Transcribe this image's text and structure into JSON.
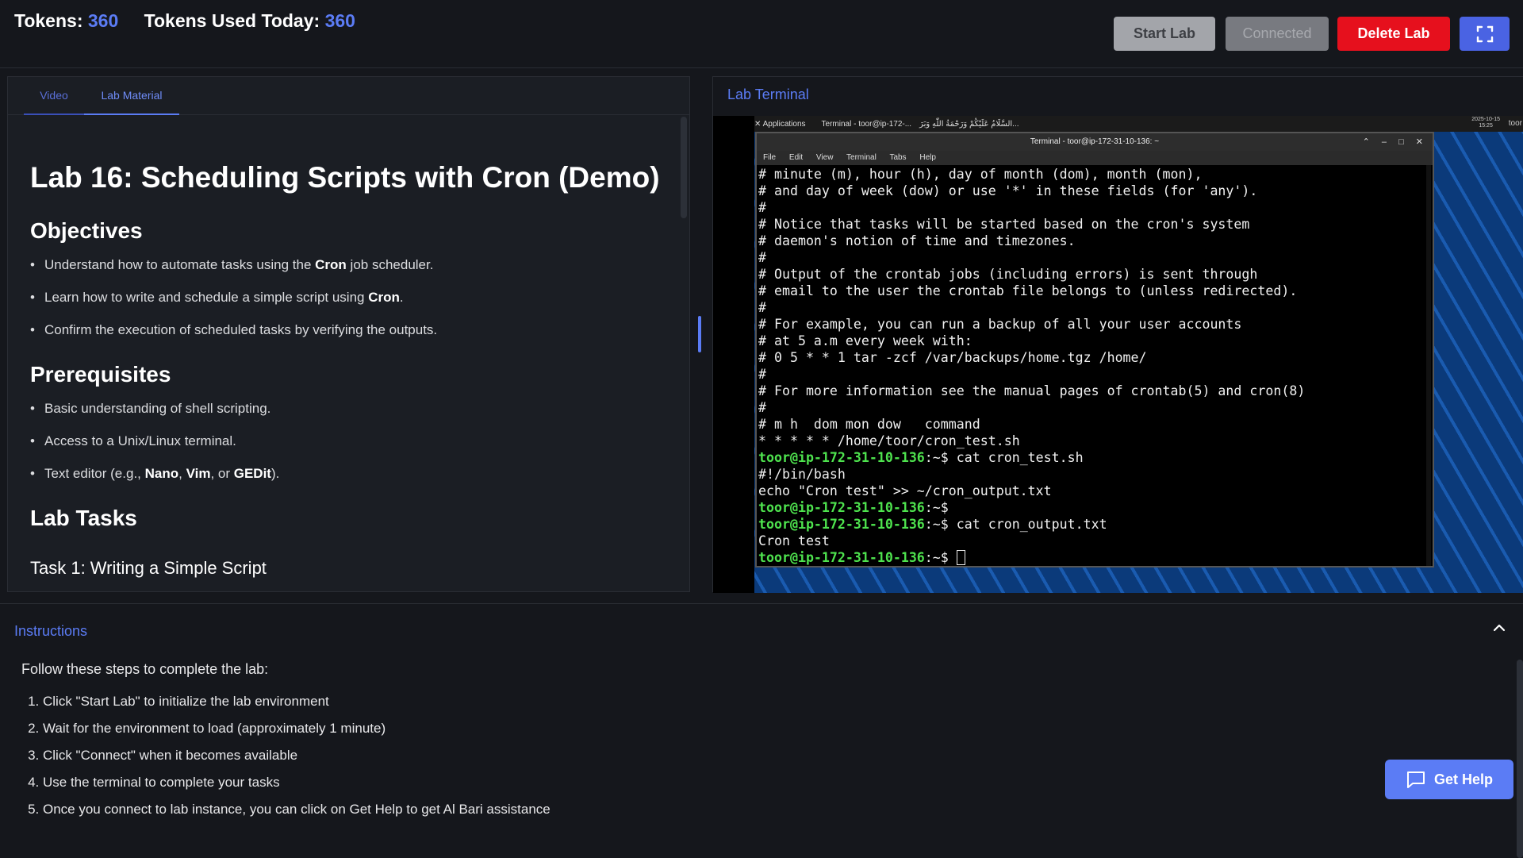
{
  "topbar": {
    "tokens_label": "Tokens:",
    "tokens_value": "360",
    "used_label": "Tokens Used Today:",
    "used_value": "360",
    "start_label": "Start Lab",
    "connected_label": "Connected",
    "delete_label": "Delete Lab",
    "fullscreen_icon": "fullscreen-icon"
  },
  "left": {
    "tabs": [
      "Video",
      "Lab Material"
    ],
    "active_tab": "Lab Material",
    "title": "Lab 16: Scheduling Scripts with Cron (Demo)",
    "objectives_heading": "Objectives",
    "objectives": [
      {
        "pre": "Understand how to automate tasks using the ",
        "bold": "Cron",
        "post": " job scheduler."
      },
      {
        "pre": "Learn how to write and schedule a simple script using ",
        "bold": "Cron",
        "post": "."
      },
      {
        "pre": "Confirm the execution of scheduled tasks by verifying the outputs.",
        "bold": "",
        "post": ""
      }
    ],
    "prereq_heading": "Prerequisites",
    "prereqs": [
      "Basic understanding of shell scripting.",
      "Access to a Unix/Linux terminal."
    ],
    "prereq_editor": {
      "pre": "Text editor (e.g., ",
      "b1": "Nano",
      "s1": ", ",
      "b2": "Vim",
      "s2": ", or ",
      "b3": "GEDit",
      "post": ")."
    },
    "tasks_heading": "Lab Tasks",
    "task1": "Task 1: Writing a Simple Script"
  },
  "right": {
    "title": "Lab Terminal",
    "panel": {
      "apps": "Applications",
      "terminal_task": "Terminal - toor@ip-172-...",
      "arabic": "السَّلَامُ عَلَيْكُمْ وَرَحْمَةُ اللّٰهِ وَبَرَ...",
      "date": "2025-10-15",
      "time": "15:25",
      "user": "toor"
    },
    "window_title": "Terminal - toor@ip-172-31-10-136: ~",
    "menu": [
      "File",
      "Edit",
      "View",
      "Terminal",
      "Tabs",
      "Help"
    ],
    "lines": [
      "# minute (m), hour (h), day of month (dom), month (mon),",
      "# and day of week (dow) or use '*' in these fields (for 'any').",
      "#",
      "# Notice that tasks will be started based on the cron's system",
      "# daemon's notion of time and timezones.",
      "#",
      "# Output of the crontab jobs (including errors) is sent through",
      "# email to the user the crontab file belongs to (unless redirected).",
      "#",
      "# For example, you can run a backup of all your user accounts",
      "# at 5 a.m every week with:",
      "# 0 5 * * 1 tar -zcf /var/backups/home.tgz /home/",
      "#",
      "# For more information see the manual pages of crontab(5) and cron(8)",
      "#",
      "# m h  dom mon dow   command",
      "* * * * * /home/toor/cron_test.sh"
    ],
    "prompt": "toor@ip-172-31-10-136",
    "prompt_suffix": ":~$ ",
    "cmd1": "cat cron_test.sh",
    "out1a": "#!/bin/bash",
    "out1b": "echo \"Cron test\" >> ~/cron_output.txt",
    "cmd2": "",
    "cmd3": "cat cron_output.txt",
    "out3": "Cron test"
  },
  "instructions": {
    "title": "Instructions",
    "intro": "Follow these steps to complete the lab:",
    "steps": [
      "Click \"Start Lab\" to initialize the lab environment",
      "Wait for the environment to load (approximately 1 minute)",
      "Click \"Connect\" when it becomes available",
      "Use the terminal to complete your tasks",
      "Once you connect to lab instance, you can click on Get Help to get Al Bari assistance"
    ],
    "collapse_icon": "chevron-up-icon"
  },
  "help": {
    "label": "Get Help",
    "icon": "chat-icon"
  }
}
